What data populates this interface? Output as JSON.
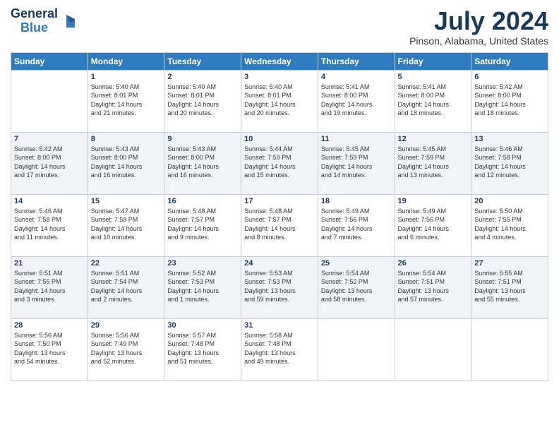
{
  "header": {
    "logo_line1": "General",
    "logo_line2": "Blue",
    "main_title": "July 2024",
    "subtitle": "Pinson, Alabama, United States"
  },
  "weekdays": [
    "Sunday",
    "Monday",
    "Tuesday",
    "Wednesday",
    "Thursday",
    "Friday",
    "Saturday"
  ],
  "weeks": [
    [
      {
        "day": "",
        "info": ""
      },
      {
        "day": "1",
        "info": "Sunrise: 5:40 AM\nSunset: 8:01 PM\nDaylight: 14 hours\nand 21 minutes."
      },
      {
        "day": "2",
        "info": "Sunrise: 5:40 AM\nSunset: 8:01 PM\nDaylight: 14 hours\nand 20 minutes."
      },
      {
        "day": "3",
        "info": "Sunrise: 5:40 AM\nSunset: 8:01 PM\nDaylight: 14 hours\nand 20 minutes."
      },
      {
        "day": "4",
        "info": "Sunrise: 5:41 AM\nSunset: 8:00 PM\nDaylight: 14 hours\nand 19 minutes."
      },
      {
        "day": "5",
        "info": "Sunrise: 5:41 AM\nSunset: 8:00 PM\nDaylight: 14 hours\nand 18 minutes."
      },
      {
        "day": "6",
        "info": "Sunrise: 5:42 AM\nSunset: 8:00 PM\nDaylight: 14 hours\nand 18 minutes."
      }
    ],
    [
      {
        "day": "7",
        "info": "Sunrise: 5:42 AM\nSunset: 8:00 PM\nDaylight: 14 hours\nand 17 minutes."
      },
      {
        "day": "8",
        "info": "Sunrise: 5:43 AM\nSunset: 8:00 PM\nDaylight: 14 hours\nand 16 minutes."
      },
      {
        "day": "9",
        "info": "Sunrise: 5:43 AM\nSunset: 8:00 PM\nDaylight: 14 hours\nand 16 minutes."
      },
      {
        "day": "10",
        "info": "Sunrise: 5:44 AM\nSunset: 7:59 PM\nDaylight: 14 hours\nand 15 minutes."
      },
      {
        "day": "11",
        "info": "Sunrise: 5:45 AM\nSunset: 7:59 PM\nDaylight: 14 hours\nand 14 minutes."
      },
      {
        "day": "12",
        "info": "Sunrise: 5:45 AM\nSunset: 7:59 PM\nDaylight: 14 hours\nand 13 minutes."
      },
      {
        "day": "13",
        "info": "Sunrise: 5:46 AM\nSunset: 7:58 PM\nDaylight: 14 hours\nand 12 minutes."
      }
    ],
    [
      {
        "day": "14",
        "info": "Sunrise: 5:46 AM\nSunset: 7:58 PM\nDaylight: 14 hours\nand 11 minutes."
      },
      {
        "day": "15",
        "info": "Sunrise: 5:47 AM\nSunset: 7:58 PM\nDaylight: 14 hours\nand 10 minutes."
      },
      {
        "day": "16",
        "info": "Sunrise: 5:48 AM\nSunset: 7:57 PM\nDaylight: 14 hours\nand 9 minutes."
      },
      {
        "day": "17",
        "info": "Sunrise: 5:48 AM\nSunset: 7:57 PM\nDaylight: 14 hours\nand 8 minutes."
      },
      {
        "day": "18",
        "info": "Sunrise: 5:49 AM\nSunset: 7:56 PM\nDaylight: 14 hours\nand 7 minutes."
      },
      {
        "day": "19",
        "info": "Sunrise: 5:49 AM\nSunset: 7:56 PM\nDaylight: 14 hours\nand 6 minutes."
      },
      {
        "day": "20",
        "info": "Sunrise: 5:50 AM\nSunset: 7:55 PM\nDaylight: 14 hours\nand 4 minutes."
      }
    ],
    [
      {
        "day": "21",
        "info": "Sunrise: 5:51 AM\nSunset: 7:55 PM\nDaylight: 14 hours\nand 3 minutes."
      },
      {
        "day": "22",
        "info": "Sunrise: 5:51 AM\nSunset: 7:54 PM\nDaylight: 14 hours\nand 2 minutes."
      },
      {
        "day": "23",
        "info": "Sunrise: 5:52 AM\nSunset: 7:53 PM\nDaylight: 14 hours\nand 1 minutes."
      },
      {
        "day": "24",
        "info": "Sunrise: 5:53 AM\nSunset: 7:53 PM\nDaylight: 13 hours\nand 59 minutes."
      },
      {
        "day": "25",
        "info": "Sunrise: 5:54 AM\nSunset: 7:52 PM\nDaylight: 13 hours\nand 58 minutes."
      },
      {
        "day": "26",
        "info": "Sunrise: 5:54 AM\nSunset: 7:51 PM\nDaylight: 13 hours\nand 57 minutes."
      },
      {
        "day": "27",
        "info": "Sunrise: 5:55 AM\nSunset: 7:51 PM\nDaylight: 13 hours\nand 55 minutes."
      }
    ],
    [
      {
        "day": "28",
        "info": "Sunrise: 5:56 AM\nSunset: 7:50 PM\nDaylight: 13 hours\nand 54 minutes."
      },
      {
        "day": "29",
        "info": "Sunrise: 5:56 AM\nSunset: 7:49 PM\nDaylight: 13 hours\nand 52 minutes."
      },
      {
        "day": "30",
        "info": "Sunrise: 5:57 AM\nSunset: 7:48 PM\nDaylight: 13 hours\nand 51 minutes."
      },
      {
        "day": "31",
        "info": "Sunrise: 5:58 AM\nSunset: 7:48 PM\nDaylight: 13 hours\nand 49 minutes."
      },
      {
        "day": "",
        "info": ""
      },
      {
        "day": "",
        "info": ""
      },
      {
        "day": "",
        "info": ""
      }
    ]
  ]
}
